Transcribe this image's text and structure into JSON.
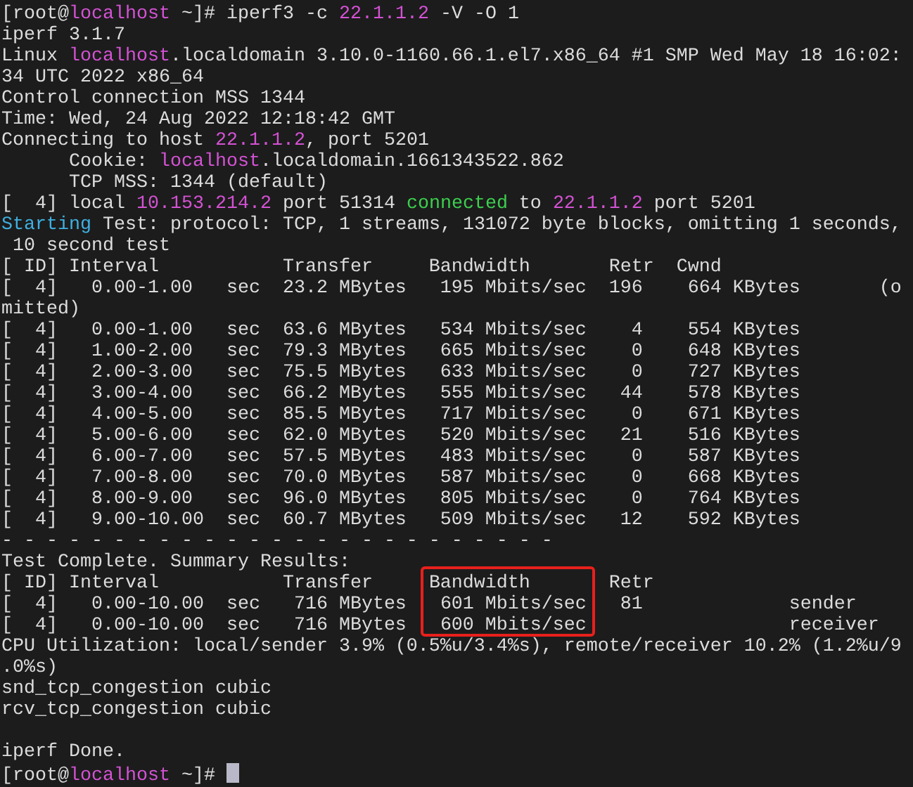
{
  "terminal": {
    "lines": [
      {
        "kind": "text",
        "segments": [
          {
            "text": "[root@"
          },
          {
            "text": "localhost",
            "color": "#d452d4"
          },
          {
            "text": " ~]# iperf3 -c "
          },
          {
            "text": "22.1.1.2",
            "color": "#d452d4"
          },
          {
            "text": " -V -O 1"
          }
        ]
      },
      {
        "kind": "text",
        "segments": [
          {
            "text": "iperf 3.1.7"
          }
        ]
      },
      {
        "kind": "text",
        "segments": [
          {
            "text": "Linux "
          },
          {
            "text": "localhost",
            "color": "#d452d4"
          },
          {
            "text": ".localdomain 3.10.0-1160.66.1.el7.x86_64 #1 SMP Wed May 18 16:02:"
          }
        ]
      },
      {
        "kind": "text",
        "segments": [
          {
            "text": "34 UTC 2022 x86_64"
          }
        ]
      },
      {
        "kind": "text",
        "segments": [
          {
            "text": "Control connection MSS 1344"
          }
        ]
      },
      {
        "kind": "text",
        "segments": [
          {
            "text": "Time: Wed, 24 Aug 2022 12:18:42 GMT"
          }
        ]
      },
      {
        "kind": "text",
        "segments": [
          {
            "text": "Connecting to host "
          },
          {
            "text": "22.1.1.2",
            "color": "#d452d4"
          },
          {
            "text": ", port 5201"
          }
        ]
      },
      {
        "kind": "text",
        "segments": [
          {
            "text": "      Cookie: "
          },
          {
            "text": "localhost",
            "color": "#d452d4"
          },
          {
            "text": ".localdomain.1661343522.862"
          }
        ]
      },
      {
        "kind": "text",
        "segments": [
          {
            "text": "      TCP MSS: 1344 (default)"
          }
        ]
      },
      {
        "kind": "text",
        "segments": [
          {
            "text": "[  4] local "
          },
          {
            "text": "10.153.214.2",
            "color": "#d452d4"
          },
          {
            "text": " port 51314 "
          },
          {
            "text": "connected",
            "color": "#3ccf4e"
          },
          {
            "text": " to "
          },
          {
            "text": "22.1.1.2",
            "color": "#d452d4"
          },
          {
            "text": " port 5201"
          }
        ]
      },
      {
        "kind": "text",
        "segments": [
          {
            "text": "Starting",
            "color": "#3fb0e0"
          },
          {
            "text": " Test: protocol: TCP, 1 streams, 131072 byte blocks, omitting 1 seconds,"
          }
        ]
      },
      {
        "kind": "text",
        "segments": [
          {
            "text": " 10 second test"
          }
        ]
      },
      {
        "kind": "text",
        "segments": [
          {
            "text": "[ ID] Interval           Transfer     Bandwidth       Retr  Cwnd"
          }
        ]
      },
      {
        "kind": "text",
        "segments": [
          {
            "text": "[  4]   0.00-1.00   sec  23.2 MBytes   195 Mbits/sec  196    664 KBytes       (o"
          }
        ]
      },
      {
        "kind": "text",
        "segments": [
          {
            "text": "mitted)"
          }
        ]
      },
      {
        "kind": "text",
        "segments": [
          {
            "text": "[  4]   0.00-1.00   sec  63.6 MBytes   534 Mbits/sec    4    554 KBytes"
          }
        ]
      },
      {
        "kind": "text",
        "segments": [
          {
            "text": "[  4]   1.00-2.00   sec  79.3 MBytes   665 Mbits/sec    0    648 KBytes"
          }
        ]
      },
      {
        "kind": "text",
        "segments": [
          {
            "text": "[  4]   2.00-3.00   sec  75.5 MBytes   633 Mbits/sec    0    727 KBytes"
          }
        ]
      },
      {
        "kind": "text",
        "segments": [
          {
            "text": "[  4]   3.00-4.00   sec  66.2 MBytes   555 Mbits/sec   44    578 KBytes"
          }
        ]
      },
      {
        "kind": "text",
        "segments": [
          {
            "text": "[  4]   4.00-5.00   sec  85.5 MBytes   717 Mbits/sec    0    671 KBytes"
          }
        ]
      },
      {
        "kind": "text",
        "segments": [
          {
            "text": "[  4]   5.00-6.00   sec  62.0 MBytes   520 Mbits/sec   21    516 KBytes"
          }
        ]
      },
      {
        "kind": "text",
        "segments": [
          {
            "text": "[  4]   6.00-7.00   sec  57.5 MBytes   483 Mbits/sec    0    587 KBytes"
          }
        ]
      },
      {
        "kind": "text",
        "segments": [
          {
            "text": "[  4]   7.00-8.00   sec  70.0 MBytes   587 Mbits/sec    0    668 KBytes"
          }
        ]
      },
      {
        "kind": "text",
        "segments": [
          {
            "text": "[  4]   8.00-9.00   sec  96.0 MBytes   805 Mbits/sec    0    764 KBytes"
          }
        ]
      },
      {
        "kind": "text",
        "segments": [
          {
            "text": "[  4]   9.00-10.00  sec  60.7 MBytes   509 Mbits/sec   12    592 KBytes"
          }
        ]
      },
      {
        "kind": "text",
        "segments": [
          {
            "text": "- - - - - - - - - - - - - - - - - - - - - - - - -"
          }
        ]
      },
      {
        "kind": "text",
        "segments": [
          {
            "text": "Test Complete. Summary Results:"
          }
        ]
      },
      {
        "kind": "text",
        "segments": [
          {
            "text": "[ ID] Interval           Transfer     ",
            "boxed": false
          },
          {
            "text": "Bandwidth",
            "boxed": true
          },
          {
            "text": "       Retr",
            "boxed": false
          }
        ]
      },
      {
        "kind": "text",
        "segments": [
          {
            "text": "[  4]   0.00-10.00  sec   716 MBytes   ",
            "boxed": false
          },
          {
            "text": "601 Mbits/sec",
            "boxed": true
          },
          {
            "text": "   81             sender",
            "boxed": false
          }
        ]
      },
      {
        "kind": "text",
        "segments": [
          {
            "text": "[  4]   0.00-10.00  sec   716 MBytes   ",
            "boxed": false
          },
          {
            "text": "600 Mbits/sec",
            "boxed": true
          },
          {
            "text": "                  receiver",
            "boxed": false
          }
        ]
      },
      {
        "kind": "text",
        "segments": [
          {
            "text": "CPU Utilization: local/sender 3.9% (0.5%u/3.4%s), remote/receiver 10.2% (1.2%u/9"
          }
        ]
      },
      {
        "kind": "text",
        "segments": [
          {
            "text": ".0%s)"
          }
        ]
      },
      {
        "kind": "text",
        "segments": [
          {
            "text": "snd_tcp_congestion cubic"
          }
        ]
      },
      {
        "kind": "text",
        "segments": [
          {
            "text": "rcv_tcp_congestion cubic"
          }
        ]
      },
      {
        "kind": "blank"
      },
      {
        "kind": "text",
        "segments": [
          {
            "text": "iperf Done."
          }
        ]
      },
      {
        "kind": "text",
        "cursor": true,
        "segments": [
          {
            "text": "[root@"
          },
          {
            "text": "localhost",
            "color": "#d452d4"
          },
          {
            "text": " ~]# "
          }
        ]
      }
    ]
  }
}
